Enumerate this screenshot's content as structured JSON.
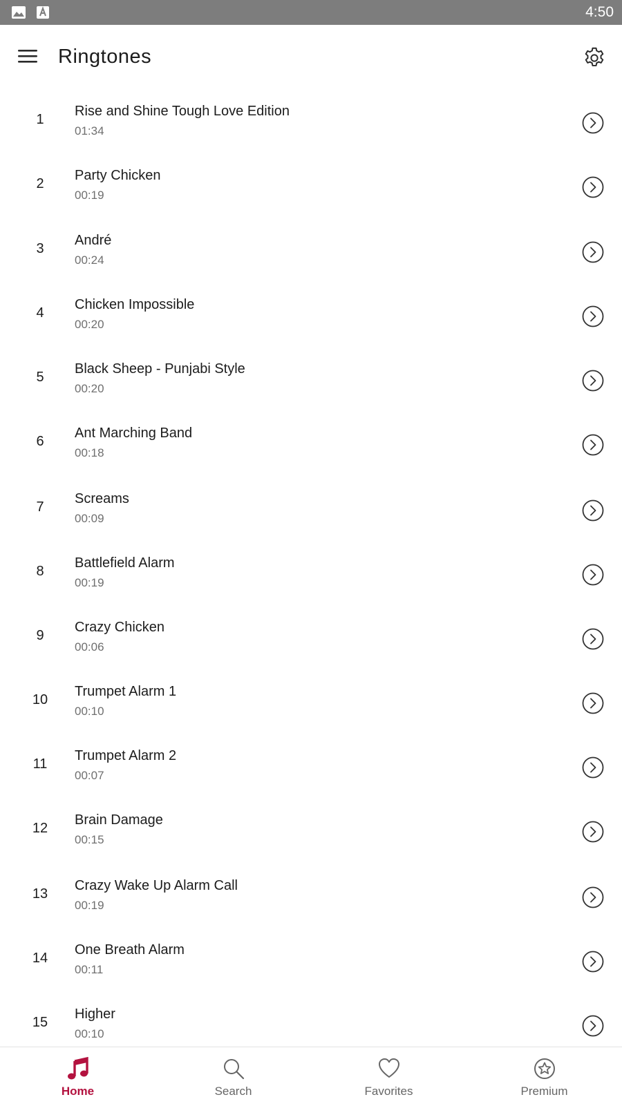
{
  "status_bar": {
    "time": "4:50",
    "icons": [
      "image-icon",
      "a-letter-icon"
    ]
  },
  "app_bar": {
    "title": "Ringtones",
    "menu_icon": "menu-icon",
    "settings_icon": "gear-icon"
  },
  "ringtones": [
    {
      "num": "1",
      "title": "Rise and Shine Tough Love Edition",
      "duration": "01:34"
    },
    {
      "num": "2",
      "title": "Party Chicken",
      "duration": "00:19"
    },
    {
      "num": "3",
      "title": "André",
      "duration": "00:24"
    },
    {
      "num": "4",
      "title": "Chicken Impossible",
      "duration": "00:20"
    },
    {
      "num": "5",
      "title": "Black Sheep - Punjabi Style",
      "duration": "00:20"
    },
    {
      "num": "6",
      "title": "Ant Marching Band",
      "duration": "00:18"
    },
    {
      "num": "7",
      "title": "Screams",
      "duration": "00:09"
    },
    {
      "num": "8",
      "title": "Battlefield Alarm",
      "duration": "00:19"
    },
    {
      "num": "9",
      "title": "Crazy Chicken",
      "duration": "00:06"
    },
    {
      "num": "10",
      "title": "Trumpet Alarm 1",
      "duration": "00:10"
    },
    {
      "num": "11",
      "title": "Trumpet Alarm 2",
      "duration": "00:07"
    },
    {
      "num": "12",
      "title": "Brain Damage",
      "duration": "00:15"
    },
    {
      "num": "13",
      "title": "Crazy Wake Up Alarm Call",
      "duration": "00:19"
    },
    {
      "num": "14",
      "title": "One Breath Alarm",
      "duration": "00:11"
    },
    {
      "num": "15",
      "title": "Higher",
      "duration": "00:10"
    }
  ],
  "bottom_nav": {
    "active_color": "#b3123f",
    "items": [
      {
        "label": "Home",
        "icon": "music-note-icon",
        "active": true
      },
      {
        "label": "Search",
        "icon": "search-icon",
        "active": false
      },
      {
        "label": "Favorites",
        "icon": "heart-icon",
        "active": false
      },
      {
        "label": "Premium",
        "icon": "star-badge-icon",
        "active": false
      }
    ]
  }
}
